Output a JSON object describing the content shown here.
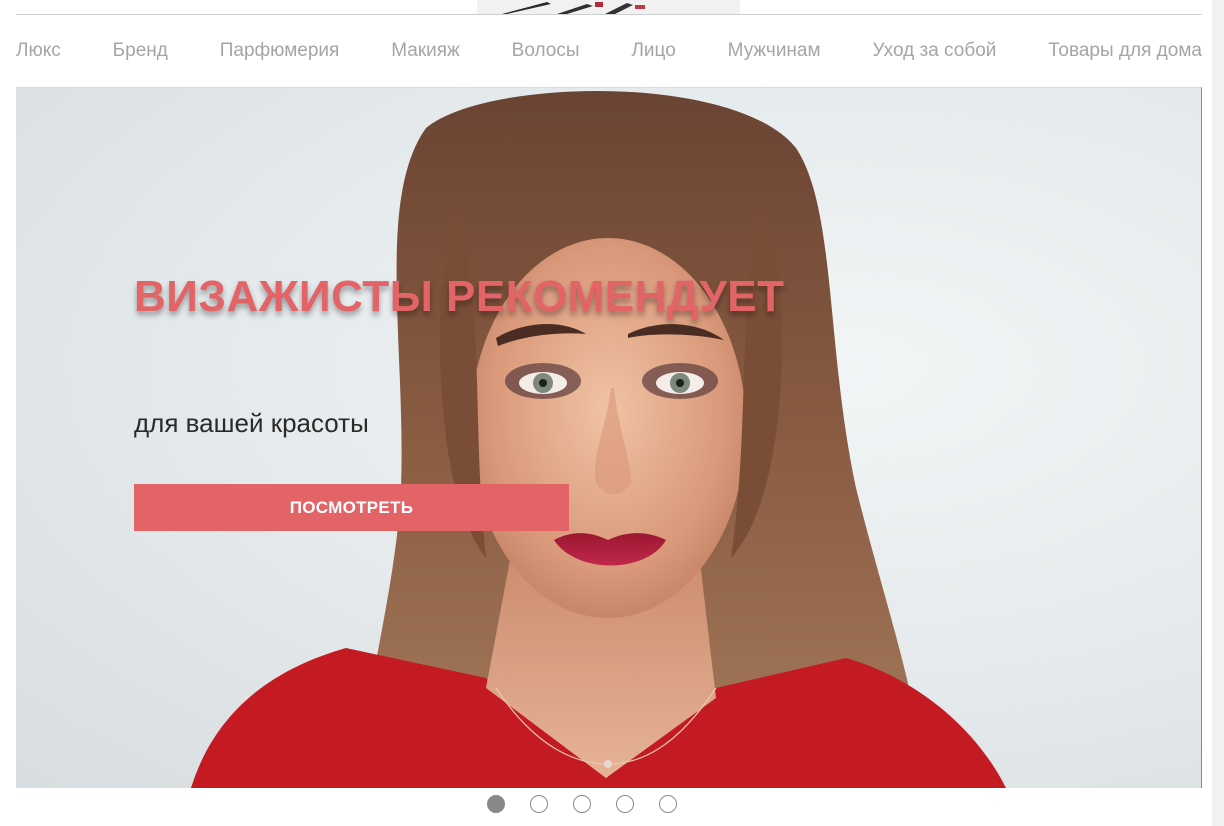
{
  "categories": [
    {
      "label": "Люкс"
    },
    {
      "label": "Бренд"
    },
    {
      "label": "Парфюмерия"
    },
    {
      "label": "Макияж"
    },
    {
      "label": "Волосы"
    },
    {
      "label": "Лицо"
    },
    {
      "label": "Мужчинам"
    },
    {
      "label": "Уход за собой"
    },
    {
      "label": "Товары для дома"
    }
  ],
  "hero": {
    "title": "ВИЗАЖИСТЫ РЕКОМЕНДУЕТ",
    "subtitle": "для вашей красоты",
    "button_label": "ПОСМОТРЕТЬ"
  },
  "carousel": {
    "slide_count": 5,
    "active_index": 0
  },
  "colors": {
    "accent": "#e36466",
    "nav_text": "#a5a5a5",
    "dot_active": "#888888"
  }
}
